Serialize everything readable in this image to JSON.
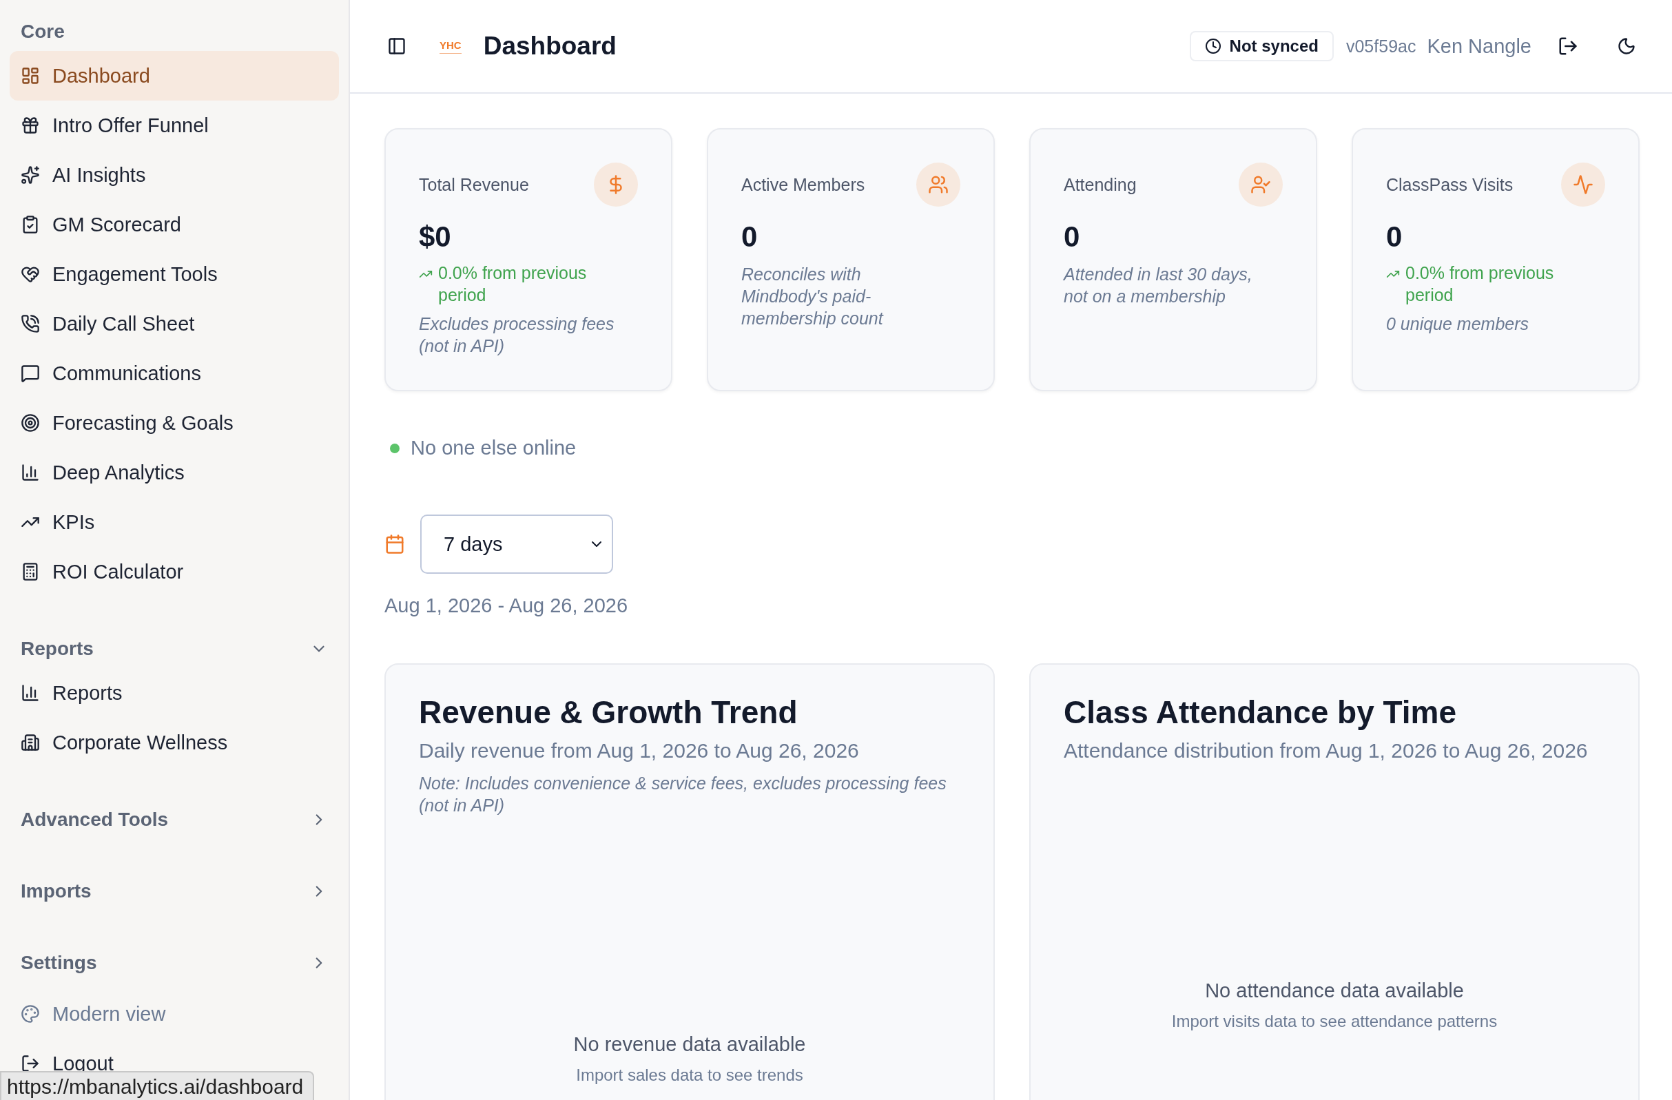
{
  "sidebar": {
    "sections": [
      {
        "title": "Core",
        "kind": "static",
        "items": [
          {
            "label": "Dashboard",
            "selected": true
          },
          {
            "label": "Intro Offer Funnel",
            "selected": false
          },
          {
            "label": "AI Insights",
            "selected": false
          },
          {
            "label": "GM Scorecard",
            "selected": false
          },
          {
            "label": "Engagement Tools",
            "selected": false
          },
          {
            "label": "Daily Call Sheet",
            "selected": false
          },
          {
            "label": "Communications",
            "selected": false
          },
          {
            "label": "Forecasting & Goals",
            "selected": false
          },
          {
            "label": "Deep Analytics",
            "selected": false
          },
          {
            "label": "KPIs",
            "selected": false
          },
          {
            "label": "ROI Calculator",
            "selected": false
          }
        ]
      },
      {
        "title": "Reports",
        "kind": "collapsible",
        "expanded": true,
        "items": [
          {
            "label": "Reports",
            "selected": false
          },
          {
            "label": "Corporate Wellness",
            "selected": false
          }
        ]
      },
      {
        "title": "Advanced Tools",
        "kind": "collapsible",
        "expanded": false
      },
      {
        "title": "Imports",
        "kind": "collapsible",
        "expanded": false
      },
      {
        "title": "Settings",
        "kind": "collapsible",
        "expanded": false
      }
    ],
    "footer": [
      {
        "label": "Modern view",
        "muted": true
      },
      {
        "label": "Logout",
        "muted": false
      }
    ]
  },
  "header": {
    "logo": "YHC",
    "title": "Dashboard",
    "sync_status": "Not synced",
    "version": "v05f59ac",
    "user": "Ken Nangle"
  },
  "stats": [
    {
      "title": "Total Revenue",
      "value": "$0",
      "change": "0.0% from previous period",
      "note": "Excludes processing fees (not in API)"
    },
    {
      "title": "Active Members",
      "value": "0",
      "note": "Reconciles with Mindbody's paid-membership count"
    },
    {
      "title": "Attending",
      "value": "0",
      "note": "Attended in last 30 days, not on a membership"
    },
    {
      "title": "ClassPass Visits",
      "value": "0",
      "change": "0.0% from previous period",
      "note": "0 unique members"
    }
  ],
  "presence": {
    "text": "No one else online",
    "color": "#5cc46a"
  },
  "range": {
    "value": "7 days",
    "dates": "Aug 1, 2026 - Aug 26, 2026"
  },
  "charts": [
    {
      "title": "Revenue & Growth Trend",
      "subtitle": "Daily revenue from Aug 1, 2026 to Aug 26, 2026",
      "note": "Note: Includes convenience & service fees, excludes processing fees (not in API)",
      "empty": "No revenue data available",
      "hint": "Import sales data to see trends"
    },
    {
      "title": "Class Attendance by Time",
      "subtitle": "Attendance distribution from Aug 1, 2026 to Aug 26, 2026",
      "empty": "No attendance data available",
      "hint": "Import visits data to see attendance patterns"
    }
  ],
  "status_url": "https://mbanalytics.ai/dashboard"
}
